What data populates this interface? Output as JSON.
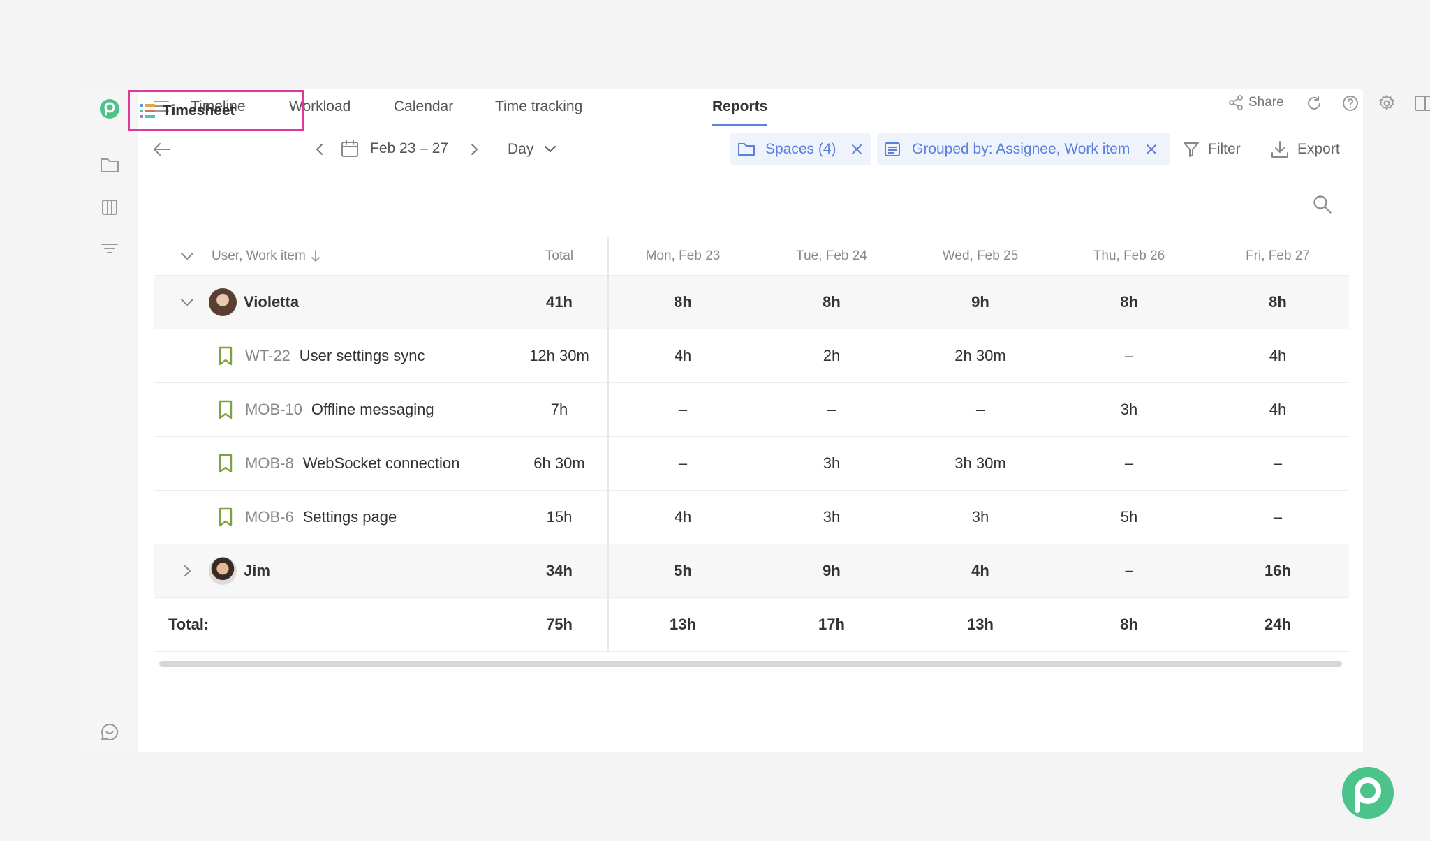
{
  "nav": {
    "tabs": [
      "Timeline",
      "Workload",
      "Calendar",
      "Time tracking",
      "Reports"
    ],
    "active_tab": "Reports",
    "share_label": "Share"
  },
  "toolbar": {
    "view_label": "Timesheet",
    "date_range": "Feb 23 – 27",
    "period": "Day",
    "spaces_chip": "Spaces (4)",
    "group_chip": "Grouped by: Assignee, Work item",
    "filter_label": "Filter",
    "export_label": "Export"
  },
  "table": {
    "headers": [
      "User, Work item",
      "Total",
      "Mon, Feb 23",
      "Tue, Feb 24",
      "Wed, Feb 25",
      "Thu, Feb 26",
      "Fri, Feb 27"
    ],
    "rows": [
      {
        "type": "group",
        "name": "Violetta",
        "total": "41h",
        "days": [
          "8h",
          "8h",
          "9h",
          "8h",
          "8h"
        ]
      },
      {
        "type": "item",
        "key": "WT-22",
        "name": "User settings sync",
        "total": "12h 30m",
        "days": [
          "4h",
          "2h",
          "2h 30m",
          "–",
          "4h"
        ]
      },
      {
        "type": "item",
        "key": "MOB-10",
        "name": "Offline messaging",
        "total": "7h",
        "days": [
          "–",
          "–",
          "–",
          "3h",
          "4h"
        ]
      },
      {
        "type": "item",
        "key": "MOB-8",
        "name": "WebSocket connection",
        "total": "6h 30m",
        "days": [
          "–",
          "3h",
          "3h 30m",
          "–",
          "–"
        ]
      },
      {
        "type": "item",
        "key": "MOB-6",
        "name": "Settings page",
        "total": "15h",
        "days": [
          "4h",
          "3h",
          "3h",
          "5h",
          "–"
        ]
      },
      {
        "type": "group",
        "name": "Jim",
        "total": "34h",
        "days": [
          "5h",
          "9h",
          "4h",
          "–",
          "16h"
        ]
      }
    ],
    "total_row": {
      "label": "Total:",
      "total": "75h",
      "days": [
        "13h",
        "17h",
        "13h",
        "8h",
        "24h"
      ]
    }
  },
  "colors": {
    "accent": "#5b7fe0",
    "brand": "#4cc38a",
    "item_icon": "#7ca33f",
    "highlight": "#e0389a"
  }
}
